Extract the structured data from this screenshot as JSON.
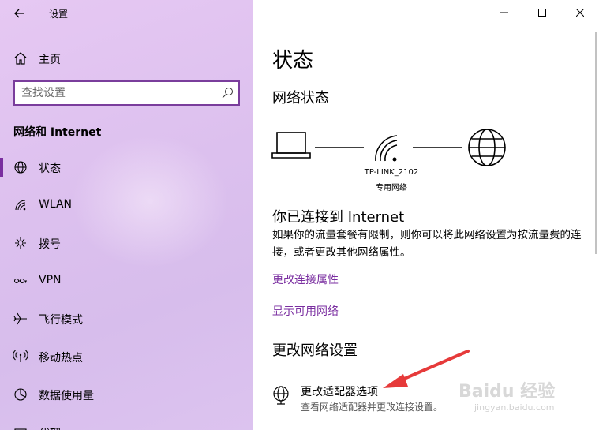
{
  "app": {
    "title": "设置"
  },
  "sidebar": {
    "home_label": "主页",
    "search_placeholder": "查找设置",
    "section_label": "网络和 Internet",
    "items": [
      {
        "label": "状态",
        "icon": "globe-icon",
        "selected": true
      },
      {
        "label": "WLAN",
        "icon": "wifi-icon"
      },
      {
        "label": "拨号",
        "icon": "dialup-icon"
      },
      {
        "label": "VPN",
        "icon": "vpn-icon"
      },
      {
        "label": "飞行模式",
        "icon": "airplane-icon"
      },
      {
        "label": "移动热点",
        "icon": "hotspot-icon"
      },
      {
        "label": "数据使用量",
        "icon": "data-usage-icon"
      },
      {
        "label": "代理",
        "icon": "proxy-icon"
      }
    ]
  },
  "content": {
    "page_title": "状态",
    "network_status_heading": "网络状态",
    "network_name": "TP-LINK_2102",
    "network_type": "专用网络",
    "connected_heading": "你已连接到 Internet",
    "description": "如果你的流量套餐有限制，则你可以将此网络设置为按流量费的连接，或者更改其他网络属性。",
    "link_change_props": "更改连接属性",
    "link_show_networks": "显示可用网络",
    "change_settings_heading": "更改网络设置",
    "adapter_title": "更改适配器选项",
    "adapter_desc": "查看网络适配器并更改连接设置。"
  },
  "watermark": {
    "text": "Baidu 经验",
    "url": "jingyan.baidu.com"
  },
  "colors": {
    "accent": "#7a2ea0",
    "search_border": "#7a3d9c",
    "annotation_arrow": "#e63a3a"
  }
}
